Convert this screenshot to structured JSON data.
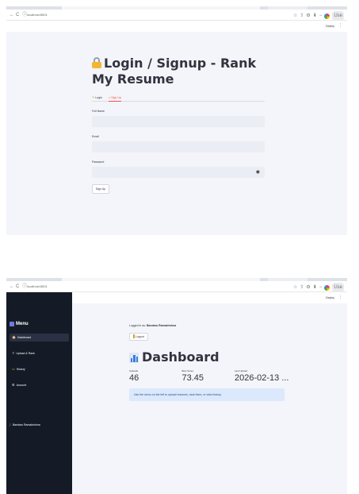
{
  "browser": {
    "url": "localhost:8501",
    "back_icon": "←",
    "reload_icon": "C",
    "info_icon": "ⓘ",
    "right_icons": [
      "☆",
      "⇧",
      "⚙",
      "⬇",
      "−"
    ],
    "profile_label": "Use"
  },
  "header": {
    "deploy_label": "Deploy",
    "menu_icon": "⋮"
  },
  "login": {
    "title": "Login / Signup - Rank My Resume",
    "tabs": [
      {
        "icon": "✎",
        "label": "Login"
      },
      {
        "icon": "⌂",
        "label": "Sign Up"
      }
    ],
    "active_tab": 1,
    "fields": [
      {
        "label": "Full Name",
        "value": ""
      },
      {
        "label": "Email",
        "value": ""
      },
      {
        "label": "Password",
        "value": ""
      }
    ],
    "eye_icon": "◉",
    "submit_label": "Sign Up"
  },
  "dashboard": {
    "sidebar": {
      "menu_label": "Menu",
      "items": [
        {
          "icon": "🏠",
          "label": "Dashboard"
        },
        {
          "icon": "⇪",
          "label": "Upload & Rank"
        },
        {
          "icon": "▭",
          "label": "History"
        },
        {
          "icon": "⚙",
          "label": "Account"
        }
      ],
      "user": "Bandaru Ramakrishna",
      "user_icon": "⎮"
    },
    "logged_in_prefix": "Logged in as:",
    "logged_in_user": "Bandaru Ramakrishna",
    "logout_label": "Logout",
    "title": "Dashboard",
    "metrics": [
      {
        "label": "Uploads",
        "value": "46"
      },
      {
        "label": "Best Score",
        "value": "73.45"
      },
      {
        "label": "Last Upload",
        "value": "2026-02-13 ..."
      }
    ],
    "info_text": "Use the menu on the left to upload resumes, rank them, or view history."
  },
  "colors": {
    "accent": "#ff4b4b",
    "sidebar": "#141a26",
    "info_bg": "#dce8fb"
  }
}
